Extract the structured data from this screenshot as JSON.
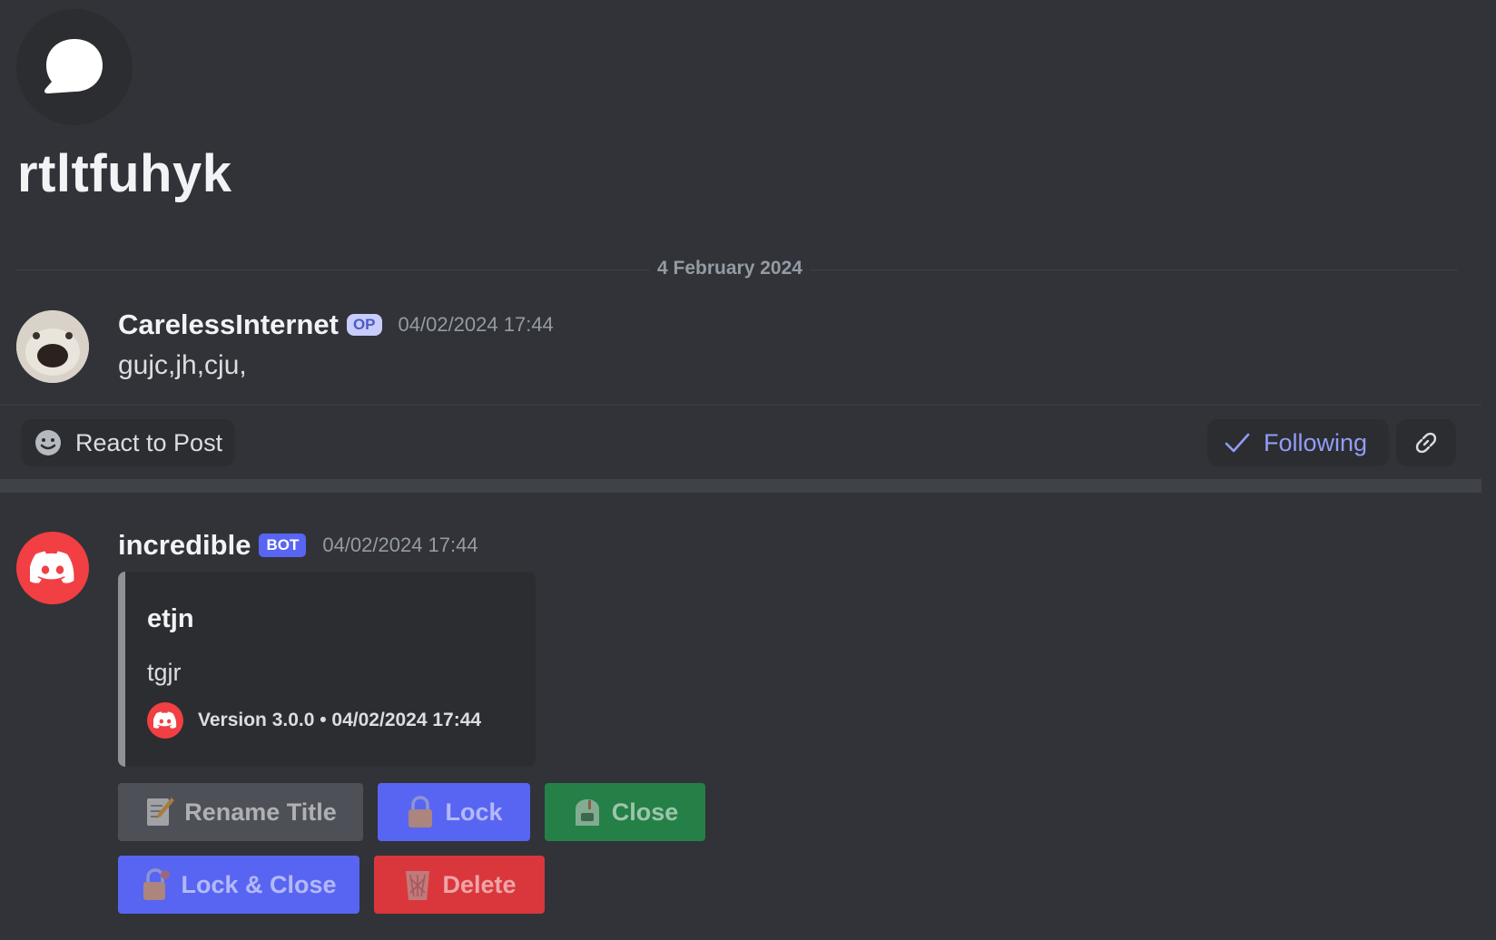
{
  "thread": {
    "title": "rtltfuhyk",
    "icon": "chat-bubble-icon",
    "date_divider": "4 February 2024"
  },
  "op_message": {
    "author": "CarelessInternet",
    "badge": "OP",
    "timestamp": "04/02/2024 17:44",
    "content": "gujc,jh,cju,"
  },
  "post_actions": {
    "react_label": "React to Post",
    "following_label": "Following",
    "link_icon": "link-icon"
  },
  "bot_message": {
    "author": "incredible",
    "badge": "BOT",
    "timestamp": "04/02/2024 17:44",
    "embed": {
      "title": "etjn",
      "description": "tgjr",
      "footer": "Version 3.0.0 • 04/02/2024 17:44"
    },
    "buttons": {
      "rename": "Rename Title",
      "lock": "Lock",
      "close": "Close",
      "lock_close": "Lock & Close",
      "delete": "Delete"
    }
  },
  "colors": {
    "background": "#313338",
    "blurple": "#5865f2",
    "green": "#248046",
    "red": "#da373c",
    "grey_button": "#4e5058",
    "following_accent": "#949cf7"
  }
}
